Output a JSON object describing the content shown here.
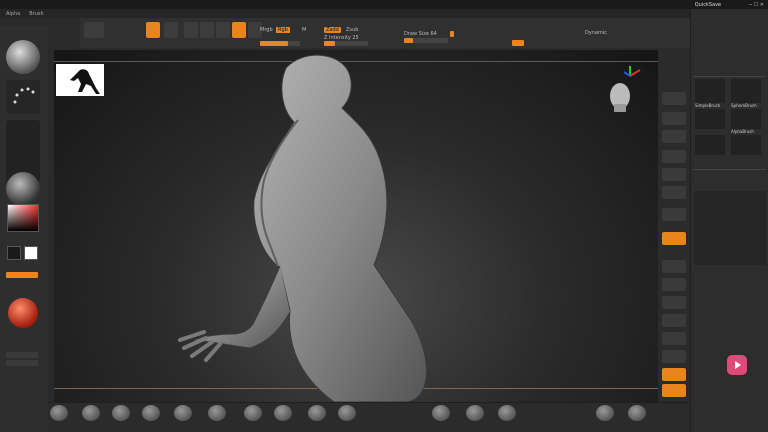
{
  "window": {
    "title": "",
    "quicksave": "QuickSave",
    "right_labels": [
      "",
      "",
      ""
    ]
  },
  "menubar": {
    "items": [
      "Alpha",
      "Brush",
      "",
      "",
      "",
      "",
      "",
      "",
      "",
      "",
      "",
      "",
      "",
      "",
      "",
      "",
      "",
      "",
      "",
      "",
      "",
      "",
      "",
      "",
      "",
      "",
      "",
      "",
      "",
      ""
    ]
  },
  "coordline": "",
  "toolbar": {
    "z_intensity": "Z Intensity 25",
    "draw_size": "Draw Size 64",
    "dynamic": "Dynamic",
    "zadd_label": "Zadd",
    "zsub_label": "Zsub",
    "rgb_label": "Rgb",
    "mrgb_label": "Mrgb",
    "m_label": "M",
    "focal_label": "",
    "focal_value": "",
    "orange_chip_a": "",
    "orange_chip_b": "",
    "rgb_intensity": "",
    "z_intensity_fill": 0.25,
    "draw_size_fill": 0.2
  },
  "leftshelf": {
    "captions": [
      "",
      "",
      "",
      "",
      "",
      ""
    ],
    "buttons": [
      "",
      "",
      ""
    ],
    "texts": [
      "",
      "",
      "",
      "",
      ""
    ]
  },
  "rightvbar": {
    "captions": [
      "",
      "",
      "",
      "",
      "",
      "",
      "",
      "",
      "",
      "",
      ""
    ]
  },
  "rightpanel": {
    "items": [
      "",
      "",
      "",
      "",
      "",
      "",
      "",
      "",
      "",
      "",
      "",
      "",
      "",
      "",
      "",
      "",
      "",
      "",
      "",
      "",
      "",
      "",
      "",
      "",
      "",
      "",
      ""
    ],
    "brushes": [
      "SimpleBrush",
      "",
      "SphereBrush",
      "AlphaBrush",
      "",
      "",
      "",
      ""
    ]
  },
  "bottomshelf": {
    "items": [
      "",
      "",
      "",
      "",
      "",
      "",
      "",
      "",
      "",
      "",
      "",
      "",
      "",
      "",
      "",
      "",
      "",
      ""
    ]
  },
  "colors": {
    "accent": "#e8851e",
    "bg": "#2a2a2a"
  }
}
